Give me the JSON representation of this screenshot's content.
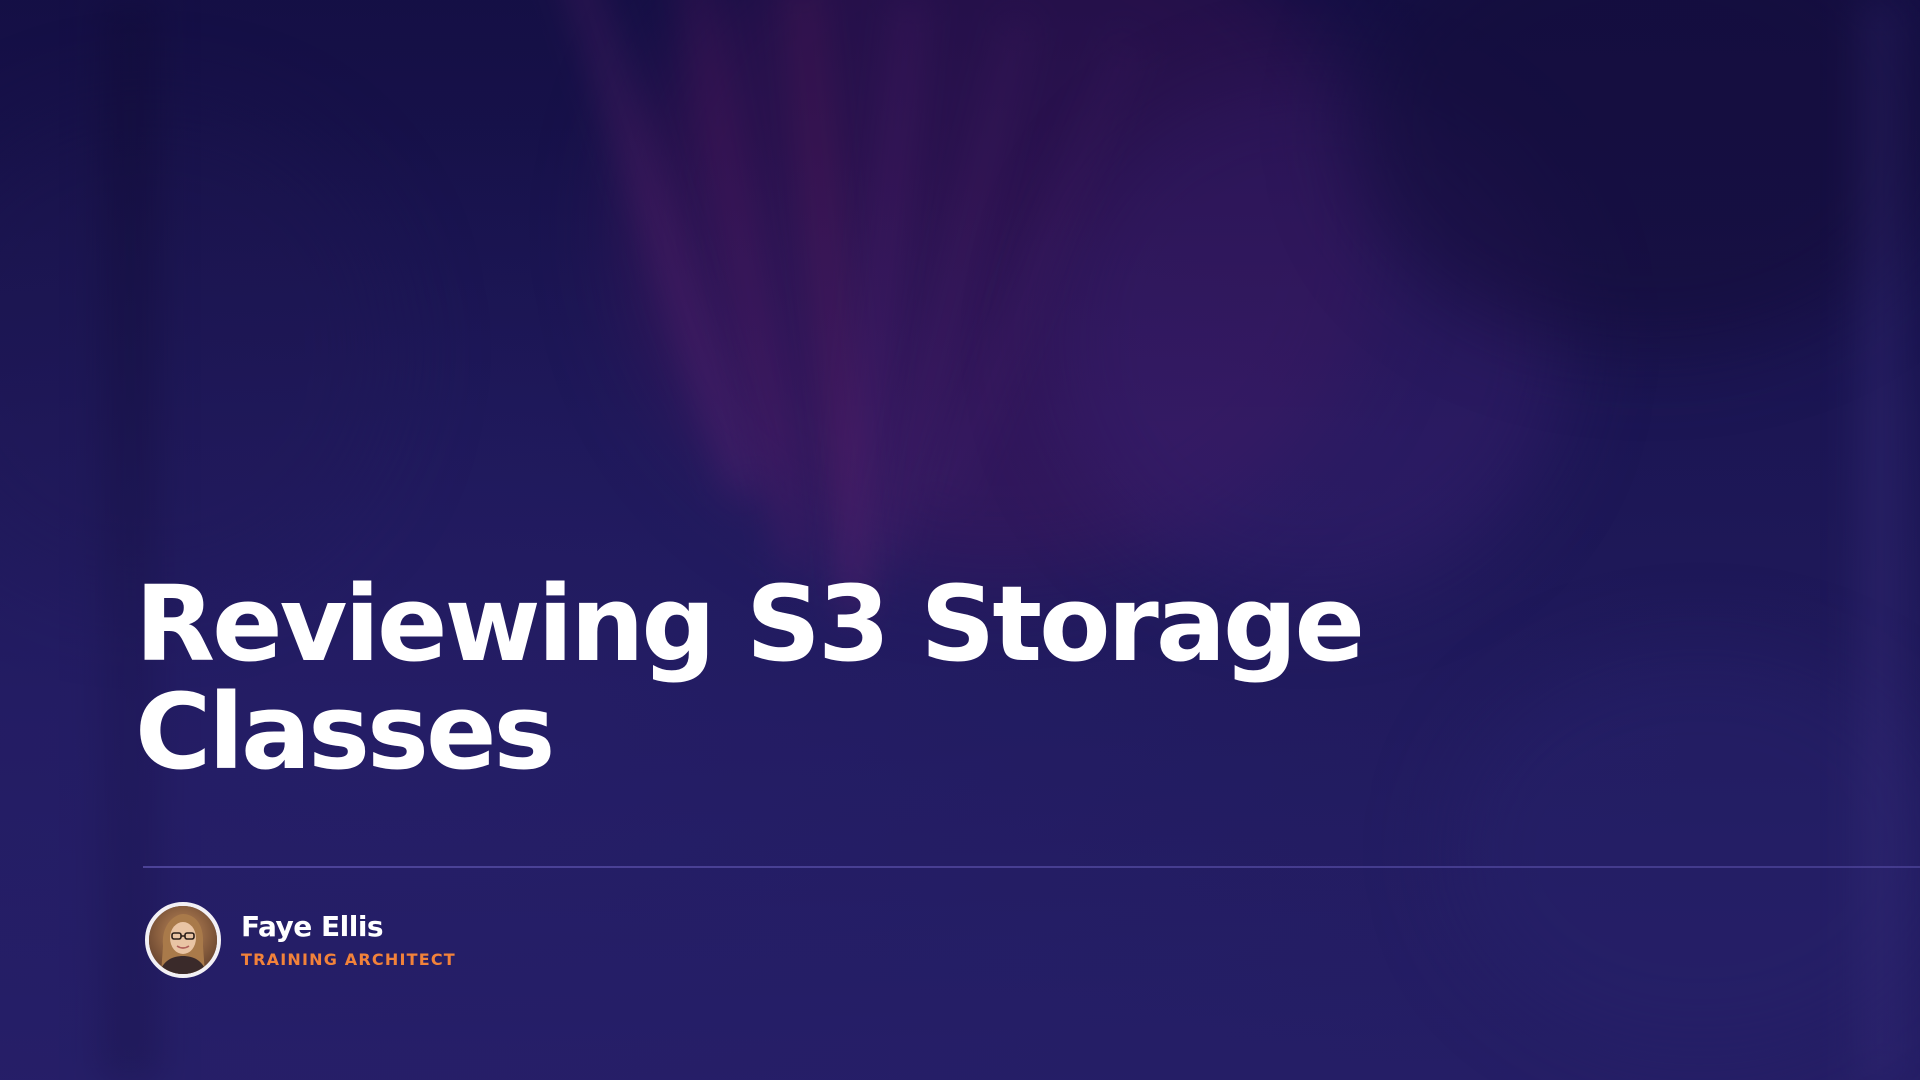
{
  "slide": {
    "title": "Reviewing S3 Storage Classes",
    "presenter": {
      "name": "Faye Ellis",
      "role": "TRAINING ARCHITECT"
    }
  },
  "colors": {
    "background": "#1e1858",
    "title_text": "#ffffff",
    "accent": "#f2823a",
    "divider": "#5a50aa"
  },
  "icons": {
    "avatar": "presenter-photo"
  }
}
